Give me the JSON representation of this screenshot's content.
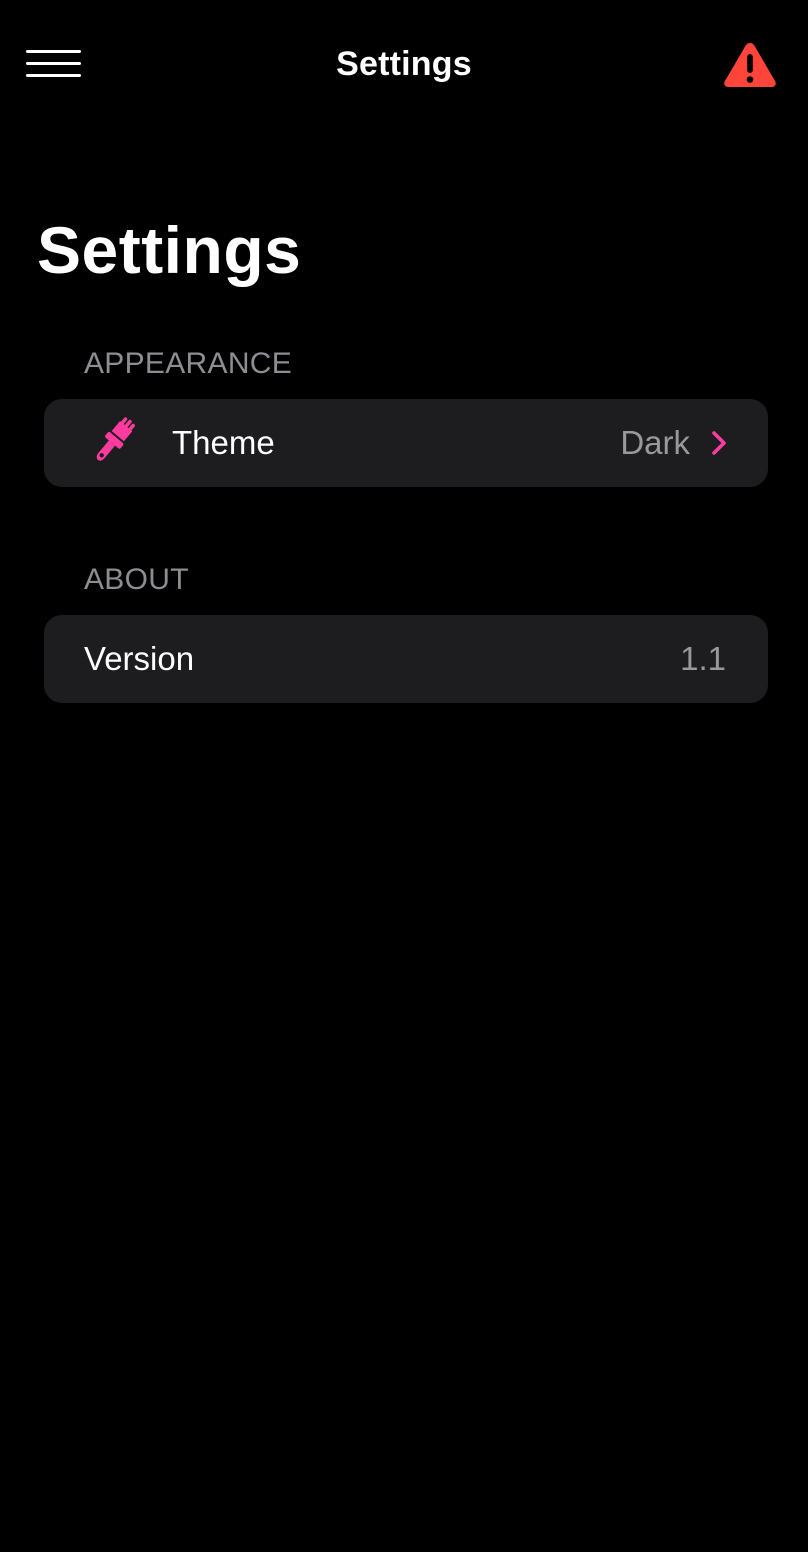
{
  "navbar": {
    "title": "Settings",
    "menu_icon": "hamburger-menu-icon",
    "alert_icon": "warning-triangle-icon"
  },
  "page": {
    "title": "Settings"
  },
  "sections": {
    "appearance": {
      "header": "APPEARANCE",
      "theme_row": {
        "icon": "paintbrush-icon",
        "label": "Theme",
        "value": "Dark",
        "accessory_icon": "chevron-right-icon"
      }
    },
    "about": {
      "header": "ABOUT",
      "version_row": {
        "label": "Version",
        "value": "1.1"
      }
    }
  },
  "colors": {
    "background": "#000000",
    "cell_background": "#1d1d1f",
    "accent": "#ff3b9d",
    "warning": "#ff453a",
    "secondary_text": "#8d8d92"
  }
}
